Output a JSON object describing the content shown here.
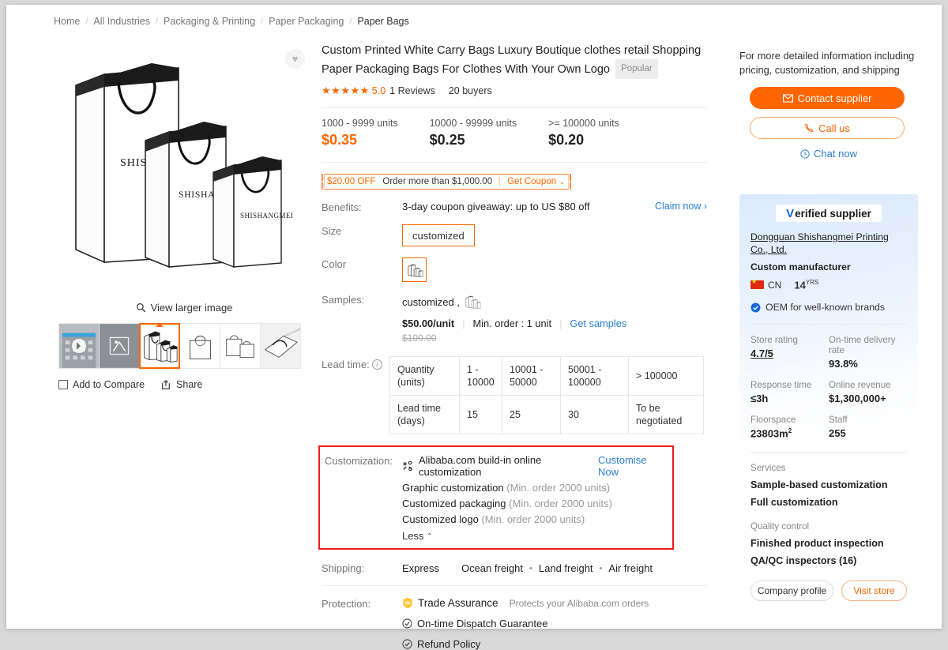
{
  "breadcrumb": {
    "items": [
      "Home",
      "All Industries",
      "Packaging & Printing",
      "Paper Packaging",
      "Paper Bags"
    ],
    "separator": "/"
  },
  "gallery": {
    "wishlist_icon": "heart-icon",
    "view_larger_label": "View larger image",
    "search_icon": "magnifier-icon",
    "main_image_alt": "Three white paper shopping bags with black trim and SHISHANGMEI logo",
    "brand_text": "SHISHANGMEI",
    "thumbnails": [
      {
        "name": "thumb-video-factory",
        "kind": "video",
        "selected": false
      },
      {
        "name": "thumb-3d-model",
        "kind": "model3d",
        "selected": false
      },
      {
        "name": "thumb-bags-trio",
        "kind": "bags",
        "selected": true
      },
      {
        "name": "thumb-bag-single",
        "kind": "bag-single",
        "selected": false
      },
      {
        "name": "thumb-bags-pair",
        "kind": "bag-pair",
        "selected": false
      },
      {
        "name": "thumb-bag-flat",
        "kind": "bag-flat",
        "selected": false
      }
    ],
    "add_to_compare": "Add to Compare",
    "share": "Share"
  },
  "product": {
    "title": "Custom Printed White Carry Bags Luxury Boutique clothes retail Shopping Paper Packaging Bags For Clothes With Your Own Logo",
    "tag": "Popular",
    "stars": "★★★★★",
    "score": "5.0",
    "reviews": "1 Reviews",
    "buyers": "20 buyers",
    "price_tiers": [
      {
        "qty": "1000 - 9999 units",
        "price": "$0.35"
      },
      {
        "qty": "10000 - 99999 units",
        "price": "$0.25"
      },
      {
        "qty": ">= 100000 units",
        "price": "$0.20"
      }
    ],
    "coupon": {
      "amount": "$20.00 OFF",
      "condition": "Order more than $1,000.00",
      "action": "Get Coupon",
      "chevron": "⌄"
    },
    "benefits": {
      "label": "Benefits:",
      "text": "3-day coupon giveaway: up to US $80 off",
      "claim": "Claim now ›"
    },
    "size": {
      "label": "Size",
      "value": "customized"
    },
    "color": {
      "label": "Color",
      "swatch_icon": "paper-bags-swatch-icon"
    },
    "samples": {
      "label": "Samples:",
      "value": "customized ,",
      "swatch_icon": "paper-bags-swatch-icon",
      "price": "$50.00/unit",
      "min_order": "Min. order : 1 unit",
      "get_samples": "Get samples",
      "old_price": "$100.00"
    },
    "lead_time": {
      "label": "Lead time:",
      "info_icon": "info-icon",
      "rows": [
        {
          "header": "Quantity (units)",
          "cells": [
            "1 - 10000",
            "10001 - 50000",
            "50001 - 100000",
            "> 100000"
          ]
        },
        {
          "header": "Lead time (days)",
          "cells": [
            "15",
            "25",
            "30",
            "To be negotiated"
          ]
        }
      ]
    },
    "customization": {
      "label": "Customization:",
      "builtin_icon": "customization-gear-icon",
      "builtin_text": "Alibaba.com build-in online customization",
      "customise_now": "Customise Now",
      "options": [
        {
          "name": "Graphic customization",
          "min": "(Min. order 2000 units)"
        },
        {
          "name": "Customized packaging",
          "min": "(Min. order 2000 units)"
        },
        {
          "name": "Customized logo",
          "min": "(Min. order 2000 units)"
        }
      ],
      "less_label": "Less",
      "less_chevron": "⌃",
      "highlight_color": "#ef1b1b"
    },
    "shipping": {
      "label": "Shipping:",
      "express": "Express",
      "methods": [
        "Ocean freight",
        "Land freight",
        "Air freight"
      ],
      "dot": "•"
    },
    "protection": {
      "label": "Protection:",
      "trade_assurance": "Trade Assurance",
      "trade_assurance_icon": "shield-icon",
      "trade_sub": "Protects your Alibaba.com orders",
      "items": [
        {
          "text": "On-time Dispatch Guarantee",
          "icon": "check-circle-icon"
        },
        {
          "text": "Refund Policy",
          "icon": "check-circle-icon"
        }
      ]
    }
  },
  "sidebar": {
    "help_text": "For more detailed information including pricing, customization, and shipping",
    "contact_supplier": "Contact supplier",
    "contact_icon": "envelope-icon",
    "call_us": "Call us",
    "call_icon": "phone-icon",
    "chat_now": "Chat now",
    "chat_icon": "chat-icon",
    "supplier": {
      "verified_badge": "Verified supplier",
      "verified_v": "V",
      "name": "Dongguan Shishangmei Printing Co., Ltd.",
      "type": "Custom manufacturer",
      "country_code": "CN",
      "country_flag_icon": "china-flag-icon",
      "years": "14",
      "years_suffix": "YRS",
      "oem_text": "OEM for well-known brands",
      "oem_icon": "verified-check-icon",
      "metrics": [
        {
          "label": "Store rating",
          "value": "4.7/5",
          "underline": true
        },
        {
          "label": "On-time delivery rate",
          "value": "93.8%",
          "underline": false
        },
        {
          "label": "Response time",
          "value": "≤3h",
          "underline": false
        },
        {
          "label": "Online revenue",
          "value": "$1,300,000+",
          "underline": false
        },
        {
          "label": "Floorspace",
          "value": "23803m",
          "sup": "2",
          "underline": false
        },
        {
          "label": "Staff",
          "value": "255",
          "underline": false
        }
      ],
      "services_label": "Services",
      "services": [
        "Sample-based customization",
        "Full customization"
      ],
      "quality_label": "Quality control",
      "quality": [
        "Finished product inspection",
        "QA/QC inspectors (16)"
      ],
      "company_profile": "Company profile",
      "visit_store": "Visit store"
    }
  },
  "colors": {
    "accent_orange": "#FF6600",
    "link_blue": "#2A7FD4",
    "highlight_red": "#EF1B1B",
    "verified_blue": "#1668DC"
  }
}
